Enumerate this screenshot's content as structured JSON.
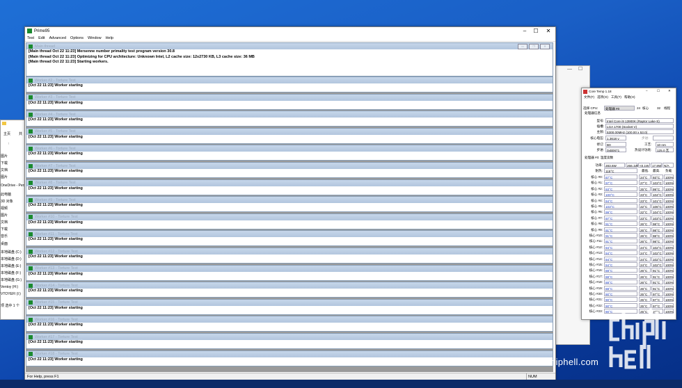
{
  "explorer": {
    "tab_label": "主页",
    "tab_label2": "共",
    "items": [
      "图片",
      "下载",
      "文档",
      "图片",
      "OneDrive - Perso",
      "此电脑",
      "3D 对象",
      "视频",
      "图片",
      "文档",
      "下载",
      "音乐",
      "桌面",
      "本地磁盘 (C:)",
      "本地磁盘 (D:)",
      "本地磁盘 (E:)",
      "本地磁盘 (F:)",
      "本地磁盘 (G:)",
      "Ventoy (H:)",
      "VTOYEFI (I:)"
    ],
    "status": "项    选中 1 个"
  },
  "prime95": {
    "title": "Prime95",
    "menu": [
      "Test",
      "Edit",
      "Advanced",
      "Options",
      "Window",
      "Help"
    ],
    "main_thread": {
      "caption": "Main thread",
      "lines": [
        "[Main thread Oct 22 11:23] Mersenne number primality test program version 30.8",
        "[Main thread Oct 22 11:23] Optimizing for CPU architecture: Unknown Intel, L2 cache size: 12x2730 KB, L3 cache size: 36 MB",
        "[Main thread Oct 22 11:23] Starting workers."
      ]
    },
    "workers": [
      {
        "caption": "Worker #2 - Torture Test",
        "line": "[Oct 22 11:23] Worker starting"
      },
      {
        "caption": "Worker #3 - Torture Test",
        "line": "[Oct 22 11:23] Worker starting"
      },
      {
        "caption": "Worker #4 - Torture Test",
        "line": "[Oct 22 11:23] Worker starting"
      },
      {
        "caption": "Worker #5 - Torture Test",
        "line": "[Oct 22 11:23] Worker starting"
      },
      {
        "caption": "Worker #6 - Torture Test",
        "line": "[Oct 22 11:23] Worker starting"
      },
      {
        "caption": "Worker #7 - Torture Test",
        "line": "[Oct 22 11:23] Worker starting"
      },
      {
        "caption": "Worker #8 - Torture Test",
        "line": "[Oct 22 11:23] Worker starting"
      },
      {
        "caption": "Worker #9 - Torture Test",
        "line": "[Oct 22 11:23] Worker starting"
      },
      {
        "caption": "Worker #10 - Torture Test",
        "line": "[Oct 22 11:23] Worker starting"
      },
      {
        "caption": "Worker #11 - Torture Test",
        "line": "[Oct 22 11:23] Worker starting"
      },
      {
        "caption": "Worker #12 - Torture Test",
        "line": "[Oct 22 11:23] Worker starting"
      },
      {
        "caption": "Worker #13 - Torture Test",
        "line": "[Oct 22 11:23] Worker starting"
      },
      {
        "caption": "Worker #14 - Torture Test",
        "line": "[Oct 22 11:23] Worker starting"
      },
      {
        "caption": "Worker #15 - Torture Test",
        "line": "[Oct 22 11:23] Worker starting"
      },
      {
        "caption": "Worker #16 - Torture Test",
        "line": "[Oct 22 11:23] Worker starting"
      },
      {
        "caption": "Worker #17 - Torture Test",
        "line": "[Oct 22 11:23] Worker starting"
      },
      {
        "caption": "Worker #18 - Torture Test",
        "line": "[Oct 22 11:23] Worker starting"
      }
    ],
    "status_help": "For Help, press F1",
    "status_num": "NUM"
  },
  "coretemp": {
    "title": "Core Temp 1.18",
    "menu": [
      "文件(F)",
      "选项(O)",
      "工具(T)",
      "帮助(H)"
    ],
    "select_cpu_label": "选择 CPU:",
    "select_cpu_value": "处理器 #0",
    "cores_count": "24",
    "cores_label": "核心",
    "threads_count": "32",
    "threads_label": "线程",
    "proc_info_label": "处理器信息",
    "model_label": "型号:",
    "model_value": "Intel Core i9 13900K (Raptor Lake-S)",
    "platform_label": "插槽:",
    "platform_value": "LGA 1700 (Socket V)",
    "freq_label": "主频:",
    "freq_value": "5300.00MHz (100.00 x 53.0)",
    "vid_label": "核心电压:",
    "vid_value": "1.3618 v",
    "mod_label": "步进:",
    "rev_label": "修订:",
    "rev_value": "B0",
    "lith_label": "工艺:",
    "lith_value": "10 nm",
    "cpuid_label": "步进:",
    "cpuid_value": "0xB0671",
    "tdp_label": "热设计功耗:",
    "tdp_value": "125.0 瓦",
    "temp_readings_label": "处理器 #0: 温度读数",
    "power_label": "功率:",
    "power_values": [
      "283.6W",
      "266.1W",
      "<0.1W",
      "17.8W",
      "N/A"
    ],
    "tjmax_label": "耐热:",
    "tjmax_value": "115°C",
    "col_min": "最低.",
    "col_max": "最高.",
    "col_load": "负载",
    "cores": [
      {
        "name": "核心 #0:",
        "temp": "87°C",
        "min": "24°C",
        "max": "93°C",
        "load": "100%"
      },
      {
        "name": "核心 #1:",
        "temp": "97°C",
        "min": "27°C",
        "max": "103°C",
        "load": "100%"
      },
      {
        "name": "核心 #2:",
        "temp": "93°C",
        "min": "25°C",
        "max": "99°C",
        "load": "100%"
      },
      {
        "name": "核心 #3:",
        "temp": "100°C",
        "min": "23°C",
        "max": "104°C",
        "load": "100%"
      },
      {
        "name": "核心 #4:",
        "temp": "94°C",
        "min": "23°C",
        "max": "101°C",
        "load": "100%"
      },
      {
        "name": "核心 #5:",
        "temp": "103°C",
        "min": "22°C",
        "max": "106°C",
        "load": "100%"
      },
      {
        "name": "核心 #6:",
        "temp": "99°C",
        "min": "22°C",
        "max": "104°C",
        "load": "100%"
      },
      {
        "name": "核心 #7:",
        "temp": "97°C",
        "min": "23°C",
        "max": "103°C",
        "load": "100%"
      },
      {
        "name": "核心 #8:",
        "temp": "91°C",
        "min": "26°C",
        "max": "98°C",
        "load": "100%"
      },
      {
        "name": "核心 #9:",
        "temp": "91°C",
        "min": "26°C",
        "max": "98°C",
        "load": "100%"
      },
      {
        "name": "核心 #10:",
        "temp": "91°C",
        "min": "26°C",
        "max": "98°C",
        "load": "100%"
      },
      {
        "name": "核心 #11:",
        "temp": "91°C",
        "min": "26°C",
        "max": "98°C",
        "load": "100%"
      },
      {
        "name": "核心 #12:",
        "temp": "94°C",
        "min": "24°C",
        "max": "102°C",
        "load": "100%"
      },
      {
        "name": "核心 #13:",
        "temp": "94°C",
        "min": "24°C",
        "max": "102°C",
        "load": "100%"
      },
      {
        "name": "核心 #14:",
        "temp": "94°C",
        "min": "24°C",
        "max": "102°C",
        "load": "100%"
      },
      {
        "name": "核心 #15:",
        "temp": "94°C",
        "min": "24°C",
        "max": "102°C",
        "load": "100%"
      },
      {
        "name": "核心 #16:",
        "temp": "88°C",
        "min": "26°C",
        "max": "91°C",
        "load": "100%"
      },
      {
        "name": "核心 #17:",
        "temp": "88°C",
        "min": "26°C",
        "max": "91°C",
        "load": "100%"
      },
      {
        "name": "核心 #18:",
        "temp": "88°C",
        "min": "26°C",
        "max": "91°C",
        "load": "100%"
      },
      {
        "name": "核心 #19:",
        "temp": "88°C",
        "min": "26°C",
        "max": "91°C",
        "load": "100%"
      },
      {
        "name": "核心 #20:",
        "temp": "90°C",
        "min": "25°C",
        "max": "97°C",
        "load": "100%"
      },
      {
        "name": "核心 #21:",
        "temp": "90°C",
        "min": "25°C",
        "max": "97°C",
        "load": "100%"
      },
      {
        "name": "核心 #22:",
        "temp": "90°C",
        "min": "25°C",
        "max": "97°C",
        "load": "100%"
      },
      {
        "name": "核心 #23:",
        "temp": "90°C",
        "min": "25°C",
        "max": "97°C",
        "load": "100%"
      }
    ]
  },
  "watermark": "www.chiphell.com"
}
